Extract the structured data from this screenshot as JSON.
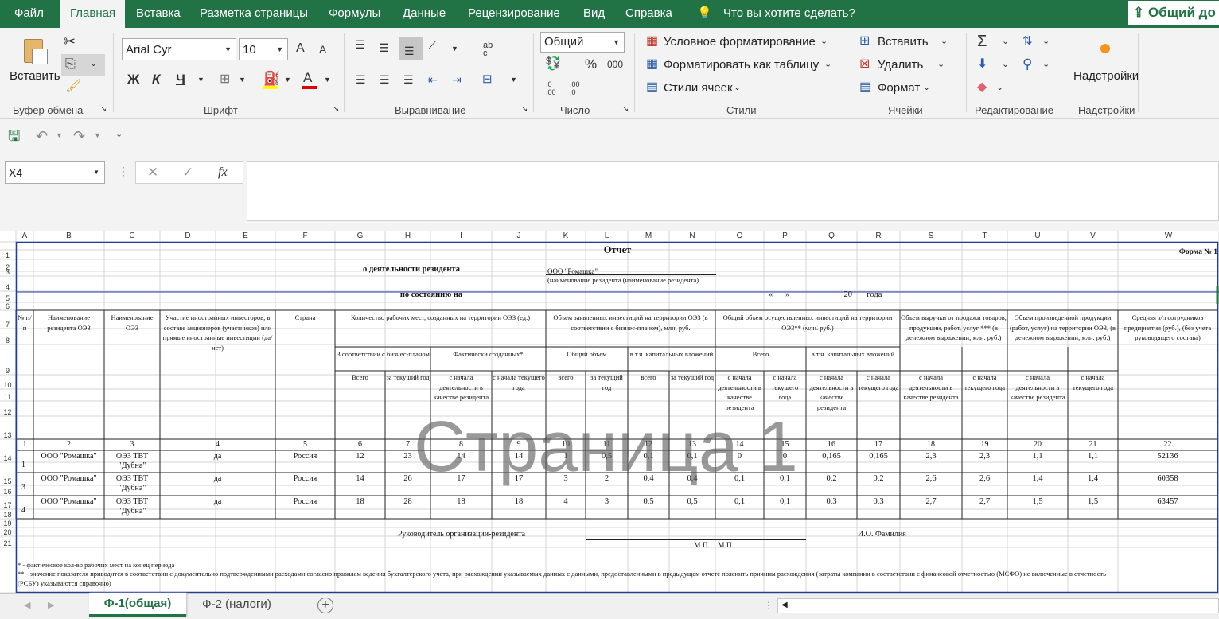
{
  "menu": {
    "tabs": [
      "Файл",
      "Главная",
      "Вставка",
      "Разметка страницы",
      "Формулы",
      "Данные",
      "Рецензирование",
      "Вид",
      "Справка"
    ],
    "tell_me": "Что вы хотите сделать?",
    "share": "Общий до"
  },
  "ribbon": {
    "clipboard": {
      "paste": "Вставить",
      "group": "Буфер обмена"
    },
    "font": {
      "name": "Arial Cyr",
      "size": "10",
      "bold": "Ж",
      "italic": "К",
      "underline": "Ч",
      "group": "Шрифт",
      "grow": "A",
      "shrink": "A",
      "color_letter": "A"
    },
    "alignment": {
      "group": "Выравнивание",
      "wrap": "ab c"
    },
    "number": {
      "format": "Общий",
      "percent": "%",
      "thousands": "000",
      "group": "Число",
      "inc": ",0 ,00",
      "dec": ",00 ,0"
    },
    "styles": {
      "conditional": "Условное форматирование",
      "as_table": "Форматировать как таблицу",
      "cell_styles": "Стили ячеек",
      "group": "Стили"
    },
    "cells": {
      "insert": "Вставить",
      "delete": "Удалить",
      "format": "Формат",
      "group": "Ячейки"
    },
    "editing": {
      "group": "Редактирование"
    },
    "addins": {
      "label": "Надстройки",
      "group": "Надстройки"
    }
  },
  "formula_bar": {
    "name_box": "X4",
    "fx": "fx",
    "value": ""
  },
  "sheet": {
    "columns": [
      "A",
      "B",
      "C",
      "D",
      "E",
      "F",
      "G",
      "H",
      "I",
      "J",
      "K",
      "L",
      "M",
      "N",
      "O",
      "P",
      "Q",
      "R",
      "S",
      "T",
      "U",
      "V",
      "W"
    ],
    "rows": [
      "1",
      "2",
      "3",
      "4",
      "5",
      "6",
      "7",
      "8",
      "9",
      "10",
      "11",
      "12",
      "13",
      "14",
      "15",
      "16",
      "17",
      "18",
      "19",
      "20",
      "21"
    ],
    "title": "Отчет",
    "form_no": "Форма № 1",
    "subtitle": "о деятельности резидента",
    "resident": "ООО \"Ромашка\"",
    "resident_note": "(наименование резидента (наименование резидента)",
    "as_of": "по состоянию на",
    "date_line": "«___» ____________ 20___ года",
    "headers": {
      "num": "№ п/п",
      "name": "Наименование резидента ОЭЗ",
      "sez": "Наименование ОЭЗ",
      "foreign": "Участие иностранных инвесторов, в составе акционеров (участников) или прямые иностранные инвестиции (да/нет)",
      "country": "Страна",
      "jobs": "Количество рабочих мест, созданных на территории ОЭЗ (ед.)",
      "jobs_plan": "В соответствии с бизнес-планом",
      "jobs_fact": "Фактически созданных*",
      "total": "Всего",
      "cur_year": "за текущий год",
      "since_start": "с начала деятельности в качестве резидента",
      "since_year": "с начала текущего года",
      "inv_declared": "Объем заявленных инвестиций на территории ОЭЗ (в соответствии с бизнес-планом), млн. руб.",
      "inv_total": "Общий объем",
      "inv_capital": "в т.ч. капитальных вложений",
      "total_lc": "всего",
      "inv_real": "Общий объем осуществленных инвестиций на территории ОЭЗ** (млн. руб.)",
      "revenue": "Объем выручки от продажи товаров, продукции, работ, услуг *** (в денежном выражении, млн. руб.)",
      "production": "Объем произведенной продукции (работ, услуг) на территории ОЭЗ, (в денежном выражении, млн. руб.)",
      "salary": "Средняя з/п сотрудников предприятия (руб.), (без учета руководящего состава)"
    },
    "col_numbers": [
      "1",
      "2",
      "3",
      "4",
      "5",
      "6",
      "7",
      "8",
      "9",
      "10",
      "11",
      "12",
      "13",
      "14",
      "15",
      "16",
      "17",
      "18",
      "19",
      "20",
      "21",
      "22"
    ],
    "data_rows": [
      {
        "n": "1",
        "name": "ООО \"Ромашка\"",
        "sez": "ОЭЗ ТВТ \"Дубна\"",
        "foreign": "да",
        "country": "Россия",
        "v": [
          "12",
          "23",
          "14",
          "14",
          "1",
          "0,5",
          "0,1",
          "0,1",
          "0",
          "0",
          "0,165",
          "0,165",
          "2,3",
          "2,3",
          "1,1",
          "1,1",
          "52136"
        ]
      },
      {
        "n": "3",
        "name": "ООО \"Ромашка\"",
        "sez": "ОЭЗ ТВТ \"Дубна\"",
        "foreign": "да",
        "country": "Россия",
        "v": [
          "14",
          "26",
          "17",
          "17",
          "3",
          "2",
          "0,4",
          "0,4",
          "0,1",
          "0,1",
          "0,2",
          "0,2",
          "2,6",
          "2,6",
          "1,4",
          "1,4",
          "60358"
        ]
      },
      {
        "n": "4",
        "name": "ООО \"Ромашка\"",
        "sez": "ОЭЗ ТВТ \"Дубна\"",
        "foreign": "да",
        "country": "Россия",
        "v": [
          "18",
          "28",
          "18",
          "18",
          "4",
          "3",
          "0,5",
          "0,5",
          "0,1",
          "0,1",
          "0,3",
          "0,3",
          "2,7",
          "2,7",
          "1,5",
          "1,5",
          "63457"
        ]
      }
    ],
    "signature_label": "Руководитель организации-резидента",
    "signature_name": "И.О. Фамилия",
    "stamp1": "М.П.",
    "stamp2": "М.П.",
    "footnote1": "* - фактическое кол-во рабочих мест на конец периода",
    "footnote2": "** - значение показателя приводится в соответствии с документально подтвержденными расходами согласно правилам ведения бухгалтерского учета, при расхождении указываемых данных с данными, предоставленными в предыдущем отчете пояснить причины расхождения (затраты компании в соответствии с финансовой отчетностью (МСФО) не включенные в отчетность",
    "footnote3": "(РСБУ) указываются справочно)",
    "watermark": "Страница 1"
  },
  "sheet_tabs": [
    "Ф-1(общая)",
    "Ф-2 (налоги)"
  ],
  "colors": {
    "brand": "#217346",
    "ribbon": "#f3f3f3",
    "border_blue": "#1f3fa0"
  }
}
